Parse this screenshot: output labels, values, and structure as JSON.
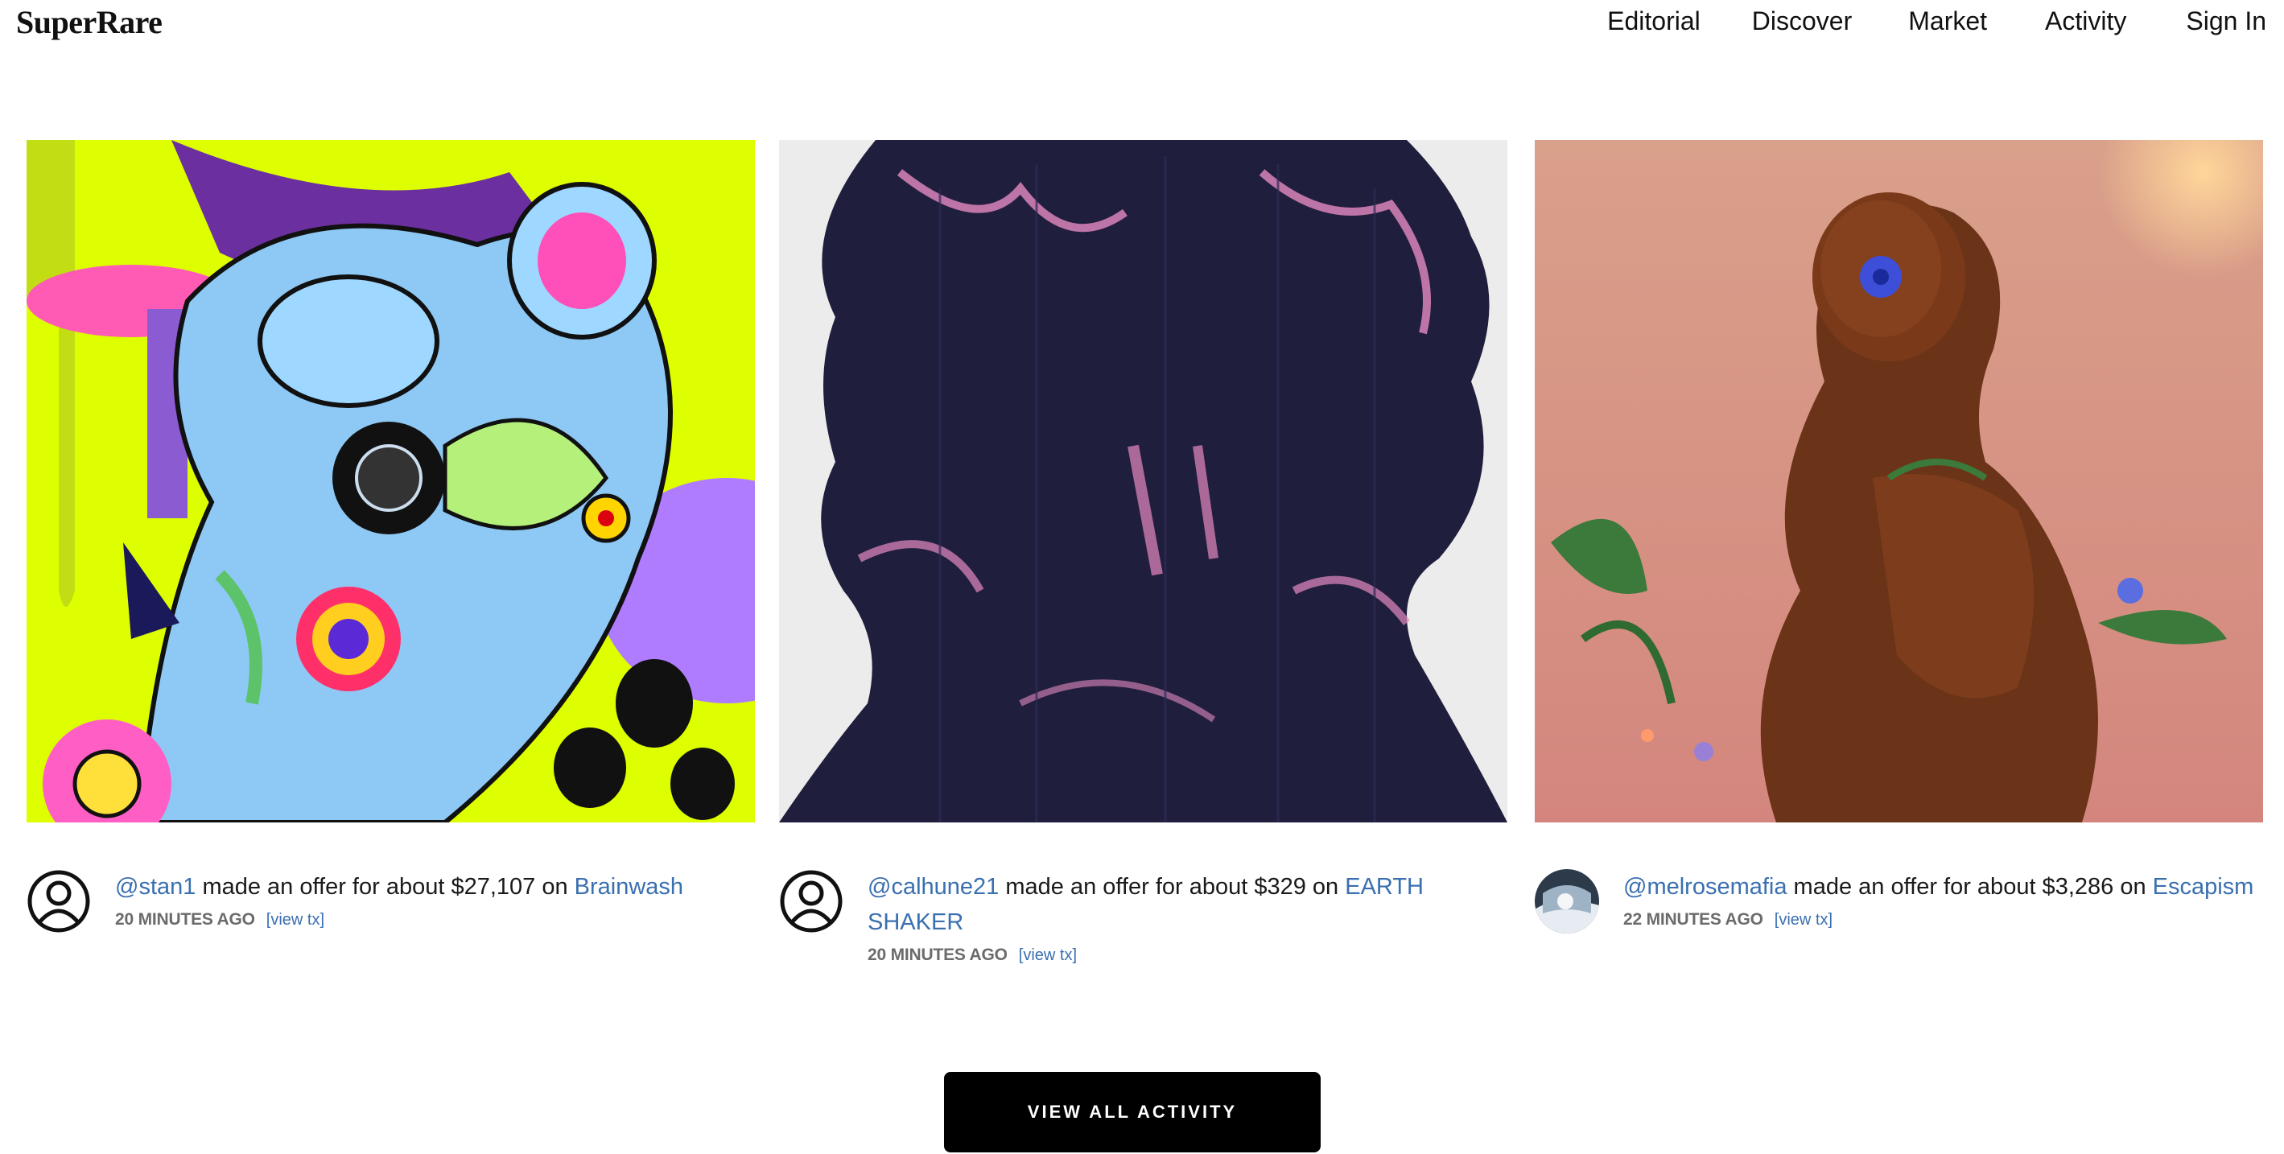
{
  "header": {
    "logo": "SuperRare",
    "nav": [
      "Editorial",
      "Discover",
      "Market",
      "Activity",
      "Sign In"
    ]
  },
  "activity": [
    {
      "user": "@stan1",
      "action": " made an offer for about $27,107 on ",
      "artwork": "Brainwash",
      "time": "20 MINUTES AGO",
      "tx_label": "[view tx]",
      "avatar_icon": "user-circle-icon"
    },
    {
      "user": "@calhune21",
      "action": " made an offer for about $329 on ",
      "artwork": "EARTH SHAKER",
      "time": "20 MINUTES AGO",
      "tx_label": "[view tx]",
      "avatar_icon": "user-circle-icon"
    },
    {
      "user": "@melrosemafia",
      "action": " made an offer for about $3,286 on ",
      "artwork": "Escapism",
      "time": "22 MINUTES AGO",
      "tx_label": "[view tx]",
      "avatar_icon": "avatar-photo"
    }
  ],
  "cta": {
    "label": "VIEW ALL ACTIVITY"
  },
  "colors": {
    "link": "#3a6fb0",
    "cta_bg": "#000000",
    "time_text": "#6b6b6b",
    "art1_bg": "#ddff00",
    "art2_ink": "#1f1e3c",
    "art2_accent": "#e58ac0",
    "art3_bg": "#d79a86"
  }
}
